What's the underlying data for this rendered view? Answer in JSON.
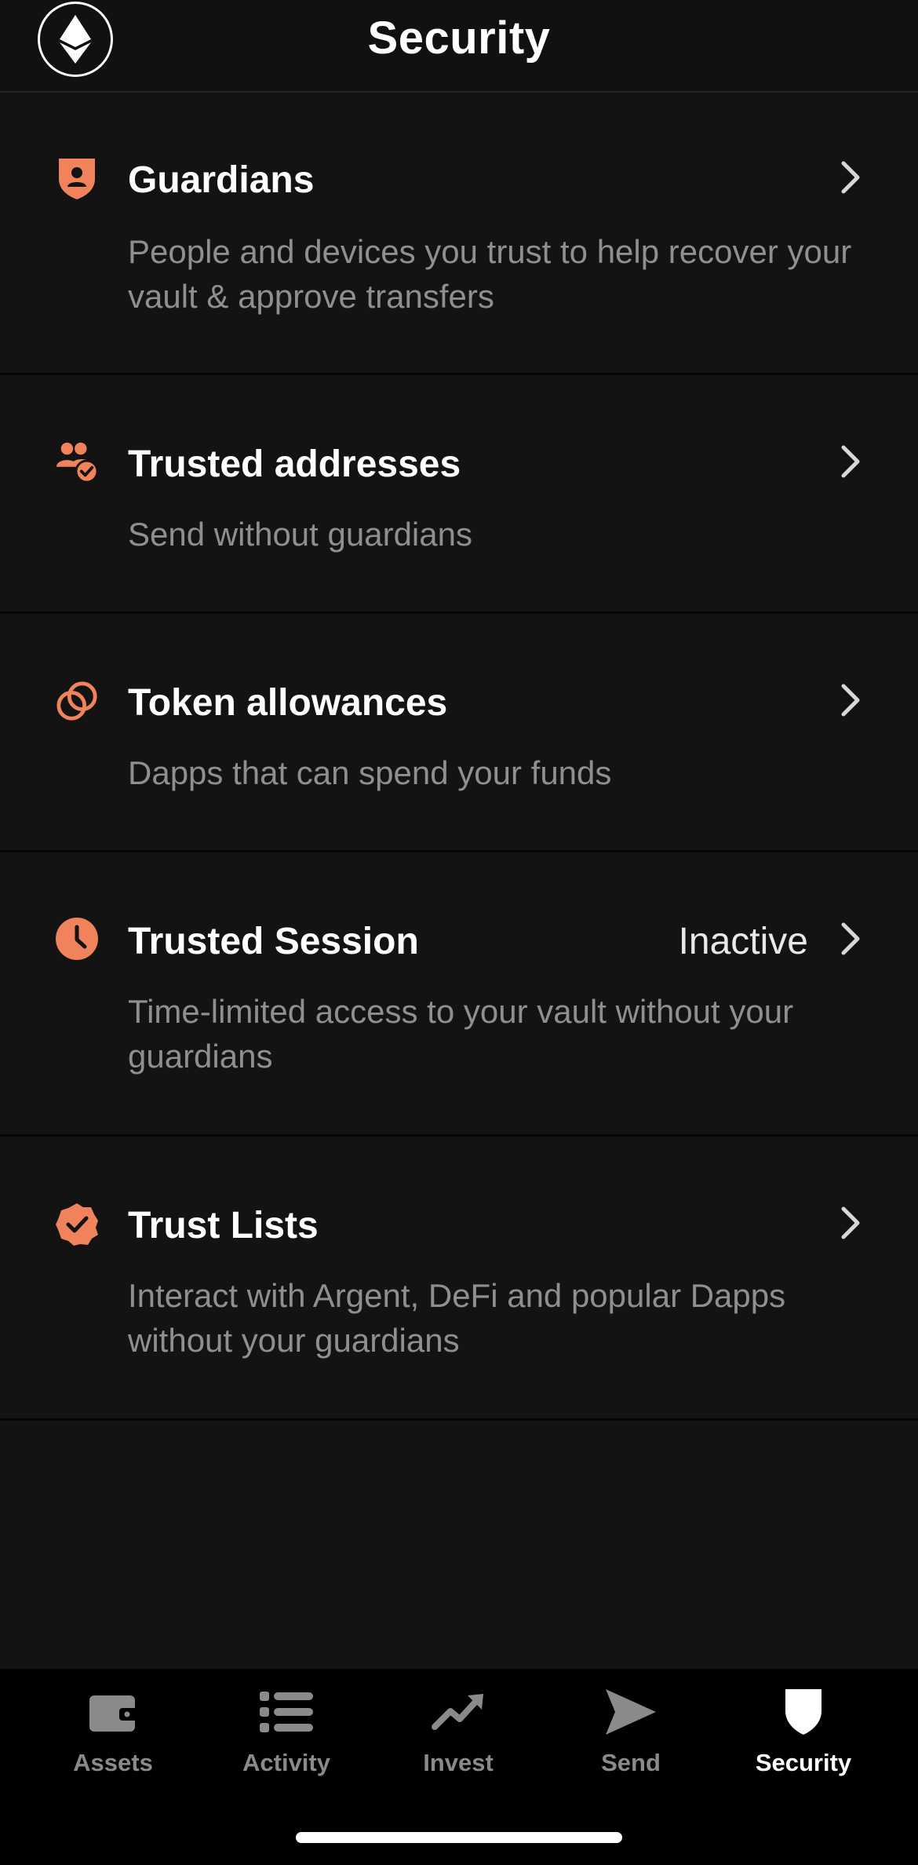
{
  "header": {
    "title": "Security",
    "network_icon": "ethereum-icon"
  },
  "rows": [
    {
      "title": "Guardians",
      "description": "People and devices you trust to help recover your vault & approve transfers",
      "icon": "shield-person-icon",
      "status": ""
    },
    {
      "title": "Trusted addresses",
      "description": "Send without guardians",
      "icon": "users-check-icon",
      "status": ""
    },
    {
      "title": "Token allowances",
      "description": "Dapps that can spend your funds",
      "icon": "link-icon",
      "status": ""
    },
    {
      "title": "Trusted Session",
      "description": "Time-limited access to your vault without your guardians",
      "icon": "clock-icon",
      "status": "Inactive"
    },
    {
      "title": "Trust Lists",
      "description": "Interact with Argent, DeFi and popular Dapps without your guardians",
      "icon": "badge-check-icon",
      "status": ""
    }
  ],
  "tabbar": {
    "tabs": [
      {
        "label": "Assets",
        "icon": "wallet-icon"
      },
      {
        "label": "Activity",
        "icon": "list-icon"
      },
      {
        "label": "Invest",
        "icon": "trending-up-icon"
      },
      {
        "label": "Send",
        "icon": "send-icon"
      },
      {
        "label": "Security",
        "icon": "shield-icon"
      }
    ],
    "active": "Security"
  },
  "colors": {
    "accent": "#F0825C",
    "background": "#131313",
    "text_secondary": "#8F8F8F",
    "tab_inactive": "#8A8A8A"
  }
}
